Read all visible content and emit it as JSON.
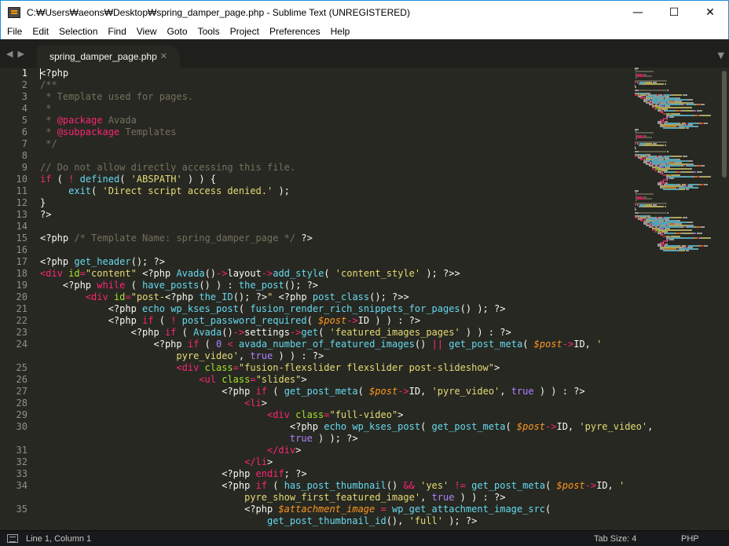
{
  "window": {
    "title": "C:₩Users₩aeons₩Desktop₩spring_damper_page.php - Sublime Text (UNREGISTERED)",
    "minimize_glyph": "—",
    "maximize_glyph": "☐",
    "close_glyph": "✕"
  },
  "menu": [
    "File",
    "Edit",
    "Selection",
    "Find",
    "View",
    "Goto",
    "Tools",
    "Project",
    "Preferences",
    "Help"
  ],
  "tabs": {
    "nav_left": "◀",
    "nav_right": "▶",
    "active_label": "spring_damper_page.php",
    "close_glyph": "✕",
    "overflow_glyph": "▼"
  },
  "gutter": [
    "1",
    "2",
    "3",
    "4",
    "5",
    "6",
    "7",
    "8",
    "9",
    "10",
    "11",
    "12",
    "13",
    "14",
    "15",
    "16",
    "17",
    "18",
    "19",
    "20",
    "21",
    "22",
    "23",
    "24",
    "",
    "25",
    "26",
    "27",
    "28",
    "29",
    "30",
    "",
    "31",
    "32",
    "33",
    "34",
    "",
    "35",
    ""
  ],
  "code_lines": [
    [
      [
        "",
        "<?php"
      ]
    ],
    [
      [
        "c",
        "/**"
      ]
    ],
    [
      [
        "c",
        " * Template used for pages."
      ]
    ],
    [
      [
        "c",
        " *"
      ]
    ],
    [
      [
        "c",
        " * "
      ],
      [
        "k",
        "@package"
      ],
      [
        "c",
        " Avada"
      ]
    ],
    [
      [
        "c",
        " * "
      ],
      [
        "k",
        "@subpackage"
      ],
      [
        "c",
        " Templates"
      ]
    ],
    [
      [
        "c",
        " */"
      ]
    ],
    [
      [
        "",
        ""
      ]
    ],
    [
      [
        "c",
        "// Do not allow directly accessing this file."
      ]
    ],
    [
      [
        "k",
        "if"
      ],
      [
        "",
        " ( "
      ],
      [
        "k",
        "!"
      ],
      [
        "",
        " "
      ],
      [
        "f",
        "defined"
      ],
      [
        "",
        "( "
      ],
      [
        "s",
        "'ABSPATH'"
      ],
      [
        "",
        " ) ) {"
      ]
    ],
    [
      [
        "",
        " \t"
      ],
      [
        "f",
        "exit"
      ],
      [
        "",
        "( "
      ],
      [
        "s",
        "'Direct script access denied.'"
      ],
      [
        "",
        " );"
      ]
    ],
    [
      [
        "",
        "}"
      ]
    ],
    [
      [
        "",
        "?>"
      ]
    ],
    [
      [
        "",
        ""
      ]
    ],
    [
      [
        "",
        "<?php "
      ],
      [
        "c",
        "/* Template Name: spring_damper_page */"
      ],
      [
        "",
        " ?>"
      ]
    ],
    [
      [
        "",
        ""
      ]
    ],
    [
      [
        "",
        "<?php "
      ],
      [
        "f",
        "get_header"
      ],
      [
        "",
        "(); ?>"
      ]
    ],
    [
      [
        "k",
        "<div"
      ],
      [
        "",
        " "
      ],
      [
        "a",
        "id"
      ],
      [
        "k",
        "="
      ],
      [
        "s",
        "\"content\""
      ],
      [
        "",
        " <?php "
      ],
      [
        "f",
        "Avada"
      ],
      [
        "",
        "()"
      ],
      [
        "k",
        "->"
      ],
      [
        "",
        "layout"
      ],
      [
        "k",
        "->"
      ],
      [
        "f",
        "add_style"
      ],
      [
        "",
        "( "
      ],
      [
        "s",
        "'content_style'"
      ],
      [
        "",
        " ); ?>>"
      ]
    ],
    [
      [
        "",
        "    <?php "
      ],
      [
        "k",
        "while"
      ],
      [
        "",
        " ( "
      ],
      [
        "f",
        "have_posts"
      ],
      [
        "",
        "() ) : "
      ],
      [
        "f",
        "the_post"
      ],
      [
        "",
        "(); ?>"
      ]
    ],
    [
      [
        "",
        "        "
      ],
      [
        "k",
        "<div"
      ],
      [
        "",
        " "
      ],
      [
        "a",
        "id"
      ],
      [
        "k",
        "="
      ],
      [
        "s",
        "\"post-"
      ],
      [
        "",
        "<?php "
      ],
      [
        "f",
        "the_ID"
      ],
      [
        "",
        "(); ?>"
      ],
      [
        "s",
        "\""
      ],
      [
        "",
        " <?php "
      ],
      [
        "f",
        "post_class"
      ],
      [
        "",
        "(); ?>>"
      ]
    ],
    [
      [
        "",
        "            <?php "
      ],
      [
        "f",
        "echo"
      ],
      [
        "",
        " "
      ],
      [
        "f",
        "wp_kses_post"
      ],
      [
        "",
        "( "
      ],
      [
        "f",
        "fusion_render_rich_snippets_for_pages"
      ],
      [
        "",
        "() ); ?>"
      ]
    ],
    [
      [
        "",
        "            <?php "
      ],
      [
        "k",
        "if"
      ],
      [
        "",
        " ( "
      ],
      [
        "k",
        "!"
      ],
      [
        "",
        " "
      ],
      [
        "f",
        "post_password_required"
      ],
      [
        "",
        "( "
      ],
      [
        "v",
        "$post"
      ],
      [
        "k",
        "->"
      ],
      [
        "",
        "ID ) ) : ?>"
      ]
    ],
    [
      [
        "",
        "                <?php "
      ],
      [
        "k",
        "if"
      ],
      [
        "",
        " ( "
      ],
      [
        "f",
        "Avada"
      ],
      [
        "",
        "()"
      ],
      [
        "k",
        "->"
      ],
      [
        "",
        "settings"
      ],
      [
        "k",
        "->"
      ],
      [
        "f",
        "get"
      ],
      [
        "",
        "( "
      ],
      [
        "s",
        "'featured_images_pages'"
      ],
      [
        "",
        " ) ) : ?>"
      ]
    ],
    [
      [
        "",
        "                    <?php "
      ],
      [
        "k",
        "if"
      ],
      [
        "",
        " ( "
      ],
      [
        "n",
        "0"
      ],
      [
        "",
        " "
      ],
      [
        "k",
        "<"
      ],
      [
        "",
        " "
      ],
      [
        "f",
        "avada_number_of_featured_images"
      ],
      [
        "",
        "() "
      ],
      [
        "k",
        "||"
      ],
      [
        "",
        " "
      ],
      [
        "f",
        "get_post_meta"
      ],
      [
        "",
        "( "
      ],
      [
        "v",
        "$post"
      ],
      [
        "k",
        "->"
      ],
      [
        "",
        "ID, "
      ],
      [
        "s",
        "'"
      ]
    ],
    [
      [
        "",
        "                        "
      ],
      [
        "s",
        "pyre_video'"
      ],
      [
        "",
        ", "
      ],
      [
        "n",
        "true"
      ],
      [
        "",
        " ) ) : ?>"
      ]
    ],
    [
      [
        "",
        "                        "
      ],
      [
        "k",
        "<div"
      ],
      [
        "",
        " "
      ],
      [
        "a",
        "class"
      ],
      [
        "k",
        "="
      ],
      [
        "s",
        "\"fusion-flexslider flexslider post-slideshow\""
      ],
      [
        "",
        ">"
      ]
    ],
    [
      [
        "",
        "                            "
      ],
      [
        "k",
        "<ul"
      ],
      [
        "",
        " "
      ],
      [
        "a",
        "class"
      ],
      [
        "k",
        "="
      ],
      [
        "s",
        "\"slides\""
      ],
      [
        "",
        ">"
      ]
    ],
    [
      [
        "",
        "                                <?php "
      ],
      [
        "k",
        "if"
      ],
      [
        "",
        " ( "
      ],
      [
        "f",
        "get_post_meta"
      ],
      [
        "",
        "( "
      ],
      [
        "v",
        "$post"
      ],
      [
        "k",
        "->"
      ],
      [
        "",
        "ID, "
      ],
      [
        "s",
        "'pyre_video'"
      ],
      [
        "",
        ", "
      ],
      [
        "n",
        "true"
      ],
      [
        "",
        " ) ) : ?>"
      ]
    ],
    [
      [
        "",
        "                                    "
      ],
      [
        "k",
        "<li"
      ],
      [
        "",
        ">"
      ]
    ],
    [
      [
        "",
        "                                        "
      ],
      [
        "k",
        "<div"
      ],
      [
        "",
        " "
      ],
      [
        "a",
        "class"
      ],
      [
        "k",
        "="
      ],
      [
        "s",
        "\"full-video\""
      ],
      [
        "",
        ">"
      ]
    ],
    [
      [
        "",
        "                                            <?php "
      ],
      [
        "f",
        "echo"
      ],
      [
        "",
        " "
      ],
      [
        "f",
        "wp_kses_post"
      ],
      [
        "",
        "( "
      ],
      [
        "f",
        "get_post_meta"
      ],
      [
        "",
        "( "
      ],
      [
        "v",
        "$post"
      ],
      [
        "k",
        "->"
      ],
      [
        "",
        "ID, "
      ],
      [
        "s",
        "'pyre_video'"
      ],
      [
        "",
        ","
      ]
    ],
    [
      [
        "",
        "                                            "
      ],
      [
        "n",
        "true"
      ],
      [
        "",
        " ) ); ?>"
      ]
    ],
    [
      [
        "",
        "                                        "
      ],
      [
        "k",
        "</div"
      ],
      [
        "",
        ">"
      ]
    ],
    [
      [
        "",
        "                                    "
      ],
      [
        "k",
        "</li"
      ],
      [
        "",
        ">"
      ]
    ],
    [
      [
        "",
        "                                <?php "
      ],
      [
        "k",
        "endif"
      ],
      [
        "",
        "; ?>"
      ]
    ],
    [
      [
        "",
        "                                <?php "
      ],
      [
        "k",
        "if"
      ],
      [
        "",
        " ( "
      ],
      [
        "f",
        "has_post_thumbnail"
      ],
      [
        "",
        "() "
      ],
      [
        "k",
        "&&"
      ],
      [
        "",
        " "
      ],
      [
        "s",
        "'yes'"
      ],
      [
        "",
        " "
      ],
      [
        "k",
        "!="
      ],
      [
        "",
        " "
      ],
      [
        "f",
        "get_post_meta"
      ],
      [
        "",
        "( "
      ],
      [
        "v",
        "$post"
      ],
      [
        "k",
        "->"
      ],
      [
        "",
        "ID, "
      ],
      [
        "s",
        "'"
      ]
    ],
    [
      [
        "",
        "                                    "
      ],
      [
        "s",
        "pyre_show_first_featured_image'"
      ],
      [
        "",
        ", "
      ],
      [
        "n",
        "true"
      ],
      [
        "",
        " ) ) : ?>"
      ]
    ],
    [
      [
        "",
        "                                    <?php "
      ],
      [
        "v",
        "$attachment_image"
      ],
      [
        "",
        " "
      ],
      [
        "k",
        "="
      ],
      [
        "",
        " "
      ],
      [
        "f",
        "wp_get_attachment_image_src"
      ],
      [
        "",
        "("
      ]
    ],
    [
      [
        "",
        "                                        "
      ],
      [
        "f",
        "get_post_thumbnail_id"
      ],
      [
        "",
        "(), "
      ],
      [
        "s",
        "'full'"
      ],
      [
        "",
        " ); ?>"
      ]
    ]
  ],
  "status": {
    "position": "Line 1, Column 1",
    "tab_size": "Tab Size: 4",
    "syntax": "PHP"
  },
  "colors": {
    "background": "#272822",
    "keyword": "#f92672",
    "function": "#66d9ef",
    "string": "#e6db74",
    "comment": "#75715e",
    "variable": "#fd971f",
    "attribute": "#a6e22e",
    "constant": "#ae81ff"
  }
}
